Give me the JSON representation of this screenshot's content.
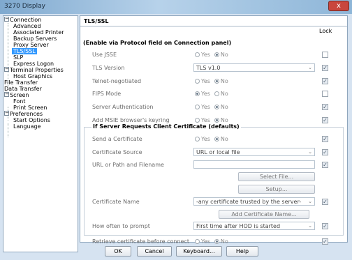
{
  "window": {
    "title": "3270 Display",
    "close_glyph": "x",
    "close_icon": "close-icon"
  },
  "tree": {
    "expand_glyph": "−",
    "items": [
      {
        "label": "Connection",
        "level": 0,
        "expander": true
      },
      {
        "label": "Advanced",
        "level": 1
      },
      {
        "label": "Associated Printer",
        "level": 1
      },
      {
        "label": "Backup Servers",
        "level": 1
      },
      {
        "label": "Proxy Server",
        "level": 1
      },
      {
        "label": "TLS/SSL",
        "level": 1,
        "selected": true
      },
      {
        "label": "SLP",
        "level": 1
      },
      {
        "label": "Express Logon",
        "level": 1
      },
      {
        "label": "Terminal Properties",
        "level": 0,
        "expander": true
      },
      {
        "label": "Host Graphics",
        "level": 1
      },
      {
        "label": "File Transfer",
        "level": 0
      },
      {
        "label": "Data Transfer",
        "level": 0
      },
      {
        "label": "Screen",
        "level": 0,
        "expander": true
      },
      {
        "label": "Font",
        "level": 1
      },
      {
        "label": "Print Screen",
        "level": 1
      },
      {
        "label": "Preferences",
        "level": 0,
        "expander": true
      },
      {
        "label": "Start Options",
        "level": 1
      },
      {
        "label": "Language",
        "level": 1
      }
    ]
  },
  "panel": {
    "title": "TLS/SSL",
    "lock_header": "Lock",
    "note": "(Enable via Protocol field on Connection panel)",
    "radio_yes": "Yes",
    "radio_no": "No",
    "check_glyph": "✓",
    "dropdown_glyph": "⌄",
    "settings": {
      "use_jsse": {
        "label": "Use JSSE",
        "selected": "No",
        "locked": false
      },
      "tls_version": {
        "label": "TLS Version",
        "value": "TLS v1.0",
        "locked": true
      },
      "telnet_negotiated": {
        "label": "Telnet-negotiated",
        "selected": "No",
        "locked": true
      },
      "fips_mode": {
        "label": "FIPS Mode",
        "selected": "Yes",
        "locked": false
      },
      "server_auth": {
        "label": "Server Authentication",
        "selected": "No",
        "locked": true
      },
      "msie_keyring": {
        "label": "Add MSIE browser's keyring",
        "selected": "No",
        "locked": true
      }
    },
    "group": {
      "title": "If Server Requests Client Certificate (defaults)",
      "send_cert": {
        "label": "Send a Certificate",
        "selected": "No",
        "locked": true
      },
      "cert_source": {
        "label": "Certificate Source",
        "value": "URL or local file",
        "locked": true
      },
      "url_path": {
        "label": "URL or Path and Filename",
        "value": "",
        "locked": true
      },
      "select_file_button": "Select File...",
      "setup_button": "Setup...",
      "cert_name": {
        "label": "Certificate Name",
        "value": "-any certificate trusted by the server-",
        "locked": true
      },
      "add_cert_button": "Add Certificate Name...",
      "prompt_freq": {
        "label": "How often to prompt",
        "value": "First time after HOD is started",
        "locked": true
      }
    },
    "retrieve_cert": {
      "label": "Retrieve certificate before connect",
      "selected": "No",
      "locked": true
    }
  },
  "buttons": {
    "ok": "OK",
    "cancel": "Cancel",
    "keyboard": "Keyboard...",
    "help": "Help"
  }
}
